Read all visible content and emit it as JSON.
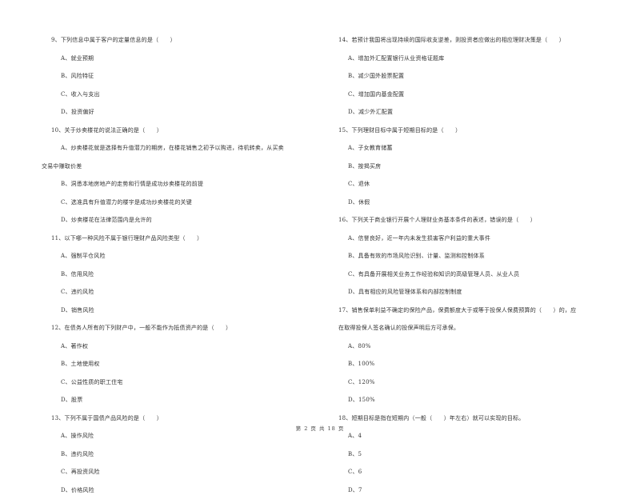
{
  "footer": {
    "page_label": "第 2 页 共 18 页"
  },
  "left_column": {
    "q9": {
      "stem": "9、下列信息中属于客户的定量信息的是（　　）",
      "options": [
        "A、就业预期",
        "B、风险特征",
        "C、收入与支出",
        "D、投资偏好"
      ]
    },
    "q10": {
      "stem": "10、关于炒卖楼花的说法正确的是（　　）",
      "option_a_line1": "A、炒卖楼花就是选择有升值潜力的期房，在楼花销售之初予以购进，待机转卖，从买卖",
      "option_a_line2": "交易中赚取价差",
      "options": [
        "B、洞悉本地房地产的走势和行情是成功炒卖楼花的前提",
        "C、选准具有升值潜力的楼宇是成功炒卖楼花的关键",
        "D、炒卖楼花在法律范围内是允许的"
      ]
    },
    "q11": {
      "stem": "11、以下哪一种风险不属于银行理财产品风险类型（　　）",
      "options": [
        "A、强制平仓风险",
        "B、信用风险",
        "C、违约风险",
        "D、销售风险"
      ]
    },
    "q12": {
      "stem": "12、在债务人所有的下列财产中，一般不能作为抵债资产的是（　　）",
      "options": [
        "A、著作权",
        "B、土地使用权",
        "C、公益性质的职工住宅",
        "D、股票"
      ]
    },
    "q13": {
      "stem": "13、下列不属于国债产品风险的是（　　）",
      "options": [
        "A、操作风险",
        "B、违约风险",
        "C、再投资风险",
        "D、价格风险"
      ]
    }
  },
  "right_column": {
    "q14": {
      "stem": "14、若预计我国将出现持续的国际收支逆差，则投资者应做出的相应理财决策是（　　）",
      "options": [
        "A、增加外汇配置银行从业资格证题库",
        "B、减少国外股票配置",
        "C、增加国内基金配置",
        "D、减少外汇配置"
      ]
    },
    "q15": {
      "stem": "15、下列理财目标中属于短期目标的是（　　）",
      "options": [
        "A、子女教育储蓄",
        "B、按揭买房",
        "C、退休",
        "D、休假"
      ]
    },
    "q16": {
      "stem": "16、下列关于商业银行开展个人理财业务基本条件的表述，错误的是（　　）",
      "options": [
        "A、信誉良好，近一年内未发生损害客户利益的重大事件",
        "B、具备有效的市场风险识别、计量、监测和控制体系",
        "C、有具备开展相关业务工作经验和知识的高级管理人员、从业人员",
        "D、具有相应的风险管理体系和内部控制制度"
      ]
    },
    "q17": {
      "stem_line1": "17、销售保单利益不确定的保险产品，保费额度大于或等于投保人保费预算的（　　）的，应",
      "stem_line2": "在取得投保人签名确认的投保声明后方可承保。",
      "options": [
        "A、80%",
        "B、100%",
        "C、120%",
        "D、150%"
      ]
    },
    "q18": {
      "stem": "18、短期目标是指在短期内（一般（　　）年左右）就可以实现的目标。",
      "options": [
        "A、4",
        "B、5",
        "C、6",
        "D、7"
      ]
    }
  }
}
